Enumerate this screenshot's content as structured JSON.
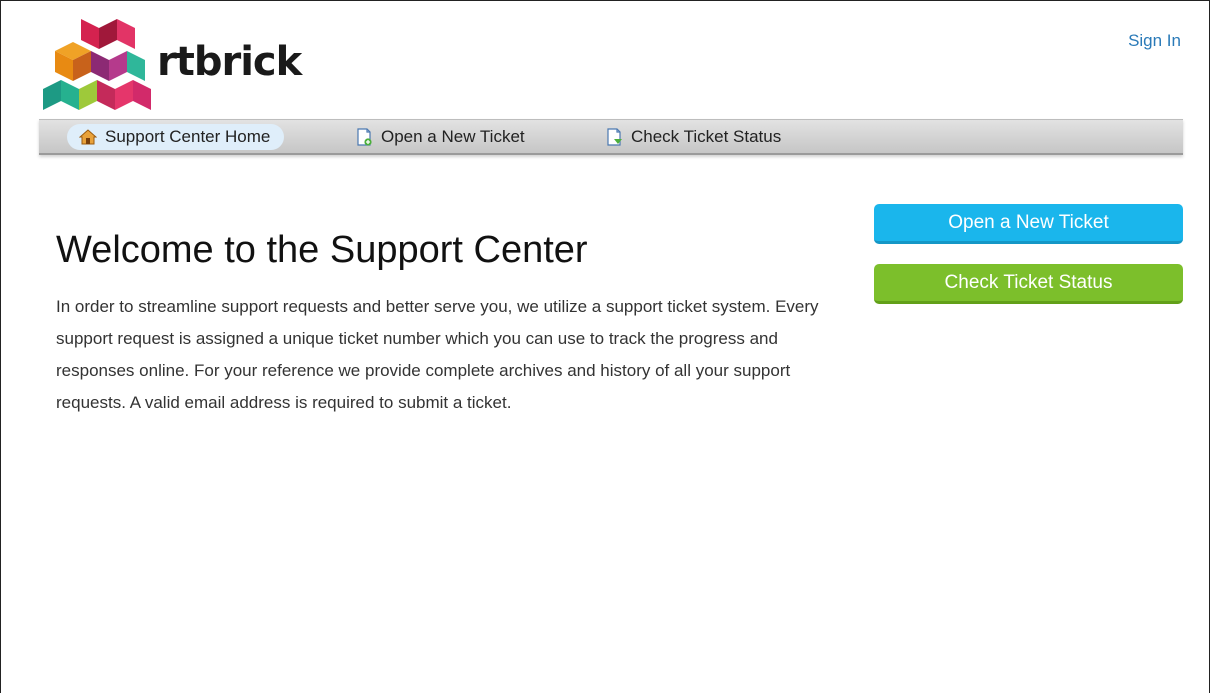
{
  "brand": {
    "name": "rtbrick"
  },
  "header": {
    "signin_label": "Sign In"
  },
  "nav": {
    "items": [
      {
        "label": "Support Center Home",
        "icon": "home-icon",
        "active": true
      },
      {
        "label": "Open a New Ticket",
        "icon": "new-ticket-icon",
        "active": false
      },
      {
        "label": "Check Ticket Status",
        "icon": "ticket-status-icon",
        "active": false
      }
    ]
  },
  "main": {
    "title": "Welcome to the Support Center",
    "intro": "In order to streamline support requests and better serve you, we utilize a support ticket system. Every support request is assigned a unique ticket number which you can use to track the progress and responses online. For your reference we provide complete archives and history of all your support requests. A valid email address is required to submit a ticket."
  },
  "sidebar": {
    "open_ticket_label": "Open a New Ticket",
    "check_status_label": "Check Ticket Status"
  },
  "colors": {
    "link": "#2a7ab8",
    "open_button": "#1ab6ec",
    "check_button": "#7cbf2b",
    "nav_active": "#dfeefa"
  }
}
